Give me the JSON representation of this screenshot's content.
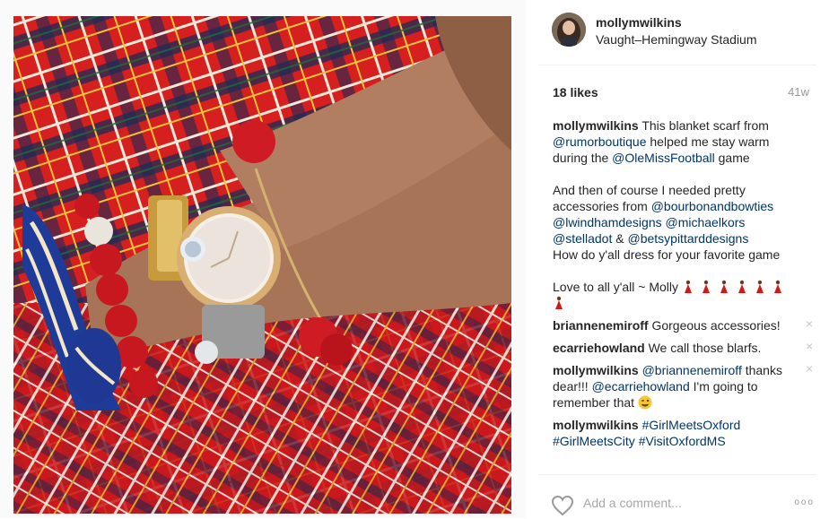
{
  "post": {
    "username": "mollymwilkins",
    "location": "Vaught–Hemingway Stadium",
    "likes": "18 likes",
    "time": "41w"
  },
  "caption": {
    "user": "mollymwilkins",
    "line1_a": "This blanket scarf from ",
    "mention1": "@rumorboutique",
    "line1_b": " helped me stay warm during the ",
    "mention2": "@OleMissFootball",
    "line1_c": " game",
    "line2_a": "And then of course I needed pretty accessories from ",
    "mention3": "@bourbonandbowties",
    "mention4": "@lwindhamdesigns",
    "mention5": "@michaelkors",
    "mention6": "@stelladot",
    "amp": " & ",
    "mention7": "@betsypittarddesigns",
    "line2_b": "How do y'all dress for your favorite game",
    "line3": "Love to all y'all ~ Molly "
  },
  "comments": [
    {
      "user": "briannenemiroff",
      "text": "Gorgeous accessories!"
    },
    {
      "user": "ecarriehowland",
      "text": "We call those blarfs."
    },
    {
      "user": "mollymwilkins",
      "mention_a": "@briannenemiroff",
      "text_a": " thanks dear!!! ",
      "mention_b": "@ecarriehowland",
      "text_b": " I'm going to remember that "
    },
    {
      "user": "mollymwilkins",
      "tag1": "#GirlMeetsOxford",
      "tag2": "#GirlMeetsCity",
      "tag3": "#VisitOxfordMS"
    }
  ],
  "footer": {
    "placeholder": "Add a comment...",
    "more": "ooo"
  },
  "icons": {
    "remove": "×",
    "heart": "heart-icon",
    "dancer": "dancer-emoji",
    "wink": "wink-emoji"
  },
  "colors": {
    "mention": "#003569",
    "text": "#262626",
    "muted": "#999999"
  }
}
